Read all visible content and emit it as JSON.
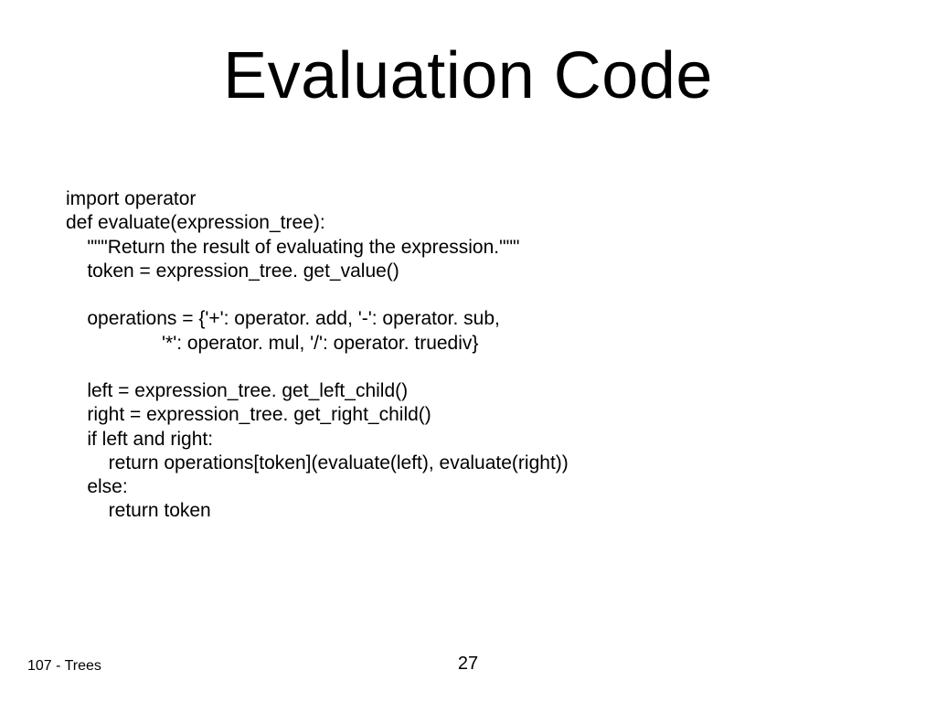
{
  "title": "Evaluation Code",
  "code": "import operator\ndef evaluate(expression_tree):\n    \"\"\"Return the result of evaluating the expression.\"\"\"\n    token = expression_tree. get_value()\n\n    operations = {'+': operator. add, '-': operator. sub,\n                  '*': operator. mul, '/': operator. truediv}\n\n    left = expression_tree. get_left_child()\n    right = expression_tree. get_right_child()\n    if left and right:\n        return operations[token](evaluate(left), evaluate(right))\n    else:\n        return token",
  "footer_left": "107 -  Trees",
  "page_number": "27"
}
